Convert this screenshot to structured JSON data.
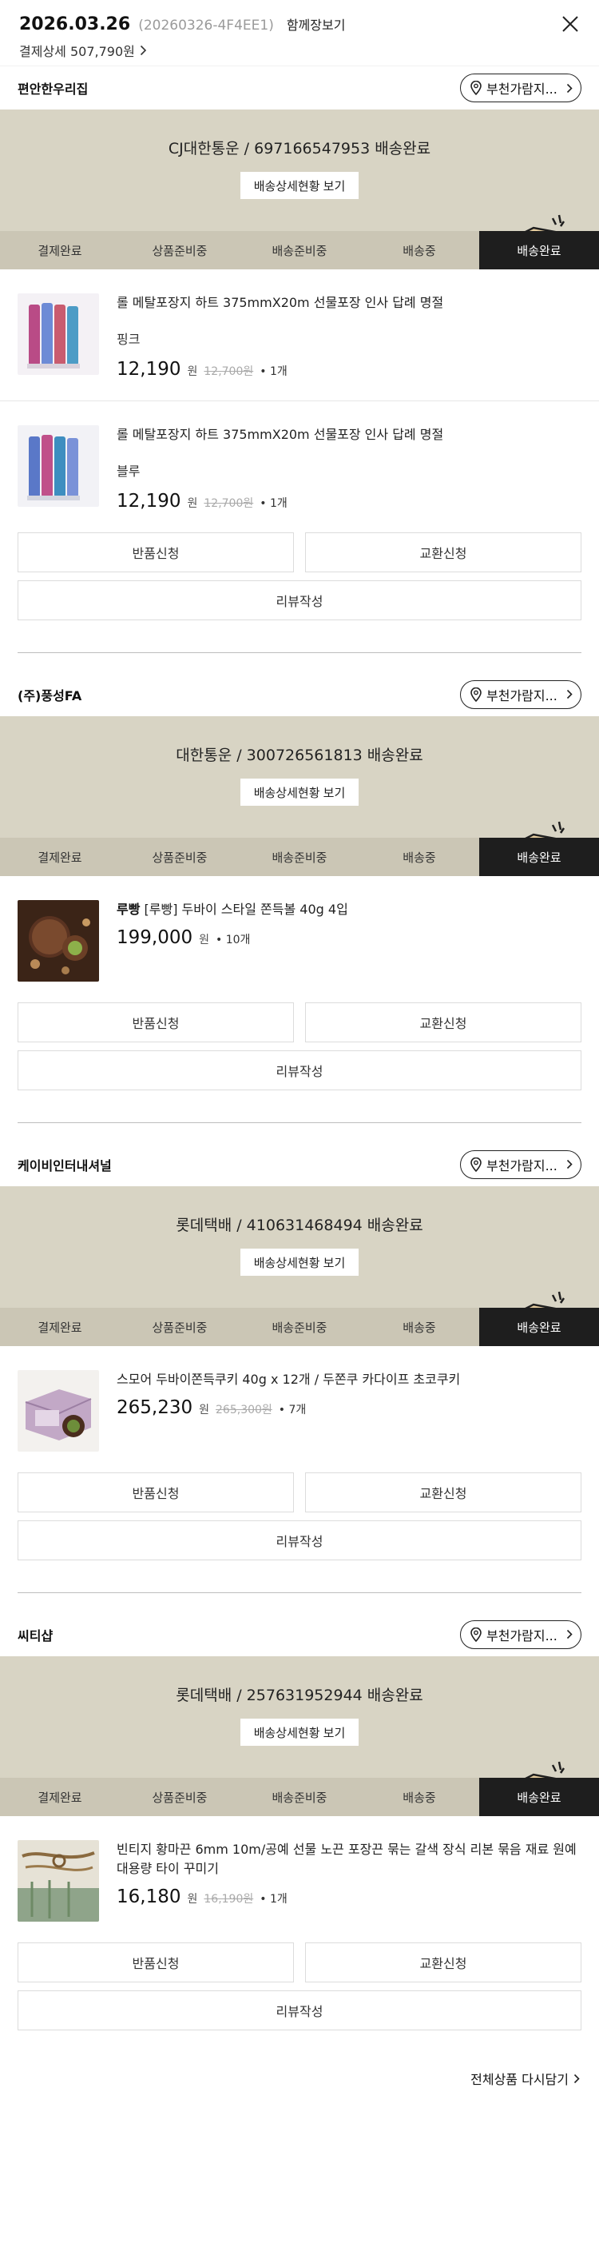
{
  "header": {
    "date": "2026.03.26",
    "order_no": "(20260326-4F4EE1)",
    "share_label": "함께장보기",
    "payment_label": "결제상세 507,790원"
  },
  "common": {
    "track_label": "배송상세현황 보기",
    "location_label": "부천가람지...",
    "return_label": "반품신청",
    "exchange_label": "교환신청",
    "review_label": "리뷰작성",
    "won": "원",
    "steps": [
      "결제완료",
      "상품준비중",
      "배송준비중",
      "배송중",
      "배송완료"
    ]
  },
  "sellers": [
    {
      "name": "편안한우리집",
      "shipping": "CJ대한통운 / 697166547953 배송완료",
      "products": [
        {
          "brand": "",
          "name": "롤 메탈포장지 하트 375mmX20m 선물포장 인사 답례 명절",
          "option": "핑크",
          "price": "12,190",
          "orig": "12,700원",
          "qty": "• 1개"
        },
        {
          "brand": "",
          "name": "롤 메탈포장지 하트 375mmX20m 선물포장 인사 답례 명절",
          "option": "블루",
          "price": "12,190",
          "orig": "12,700원",
          "qty": "• 1개"
        }
      ]
    },
    {
      "name": "(주)풍성FA",
      "shipping": "대한통운 / 300726561813 배송완료",
      "products": [
        {
          "brand": "루빵",
          "name": " [루빵] 두바이 스타일 쫀득볼 40g 4입",
          "option": "",
          "price": "199,000",
          "orig": "",
          "qty": "• 10개"
        }
      ]
    },
    {
      "name": "케이비인터내셔널",
      "shipping": "롯데택배 / 410631468494 배송완료",
      "products": [
        {
          "brand": "",
          "name": "스모어 두바이쫀득쿠키 40g x 12개 / 두쫀쿠 카다이프 초코쿠키",
          "option": "",
          "price": "265,230",
          "orig": "265,300원",
          "qty": "• 7개"
        }
      ]
    },
    {
      "name": "씨티샵",
      "shipping": "롯데택배 / 257631952944 배송완료",
      "products": [
        {
          "brand": "",
          "name": "빈티지 황마끈 6mm 10m/공예 선물 노끈 포장끈 묶는 갈색 장식 리본 묶음 재료 원예 대용량 타이 꾸미기",
          "option": "",
          "price": "16,180",
          "orig": "16,190원",
          "qty": "• 1개"
        }
      ]
    }
  ],
  "footer": {
    "redeem_label": "전체상품 다시담기"
  }
}
